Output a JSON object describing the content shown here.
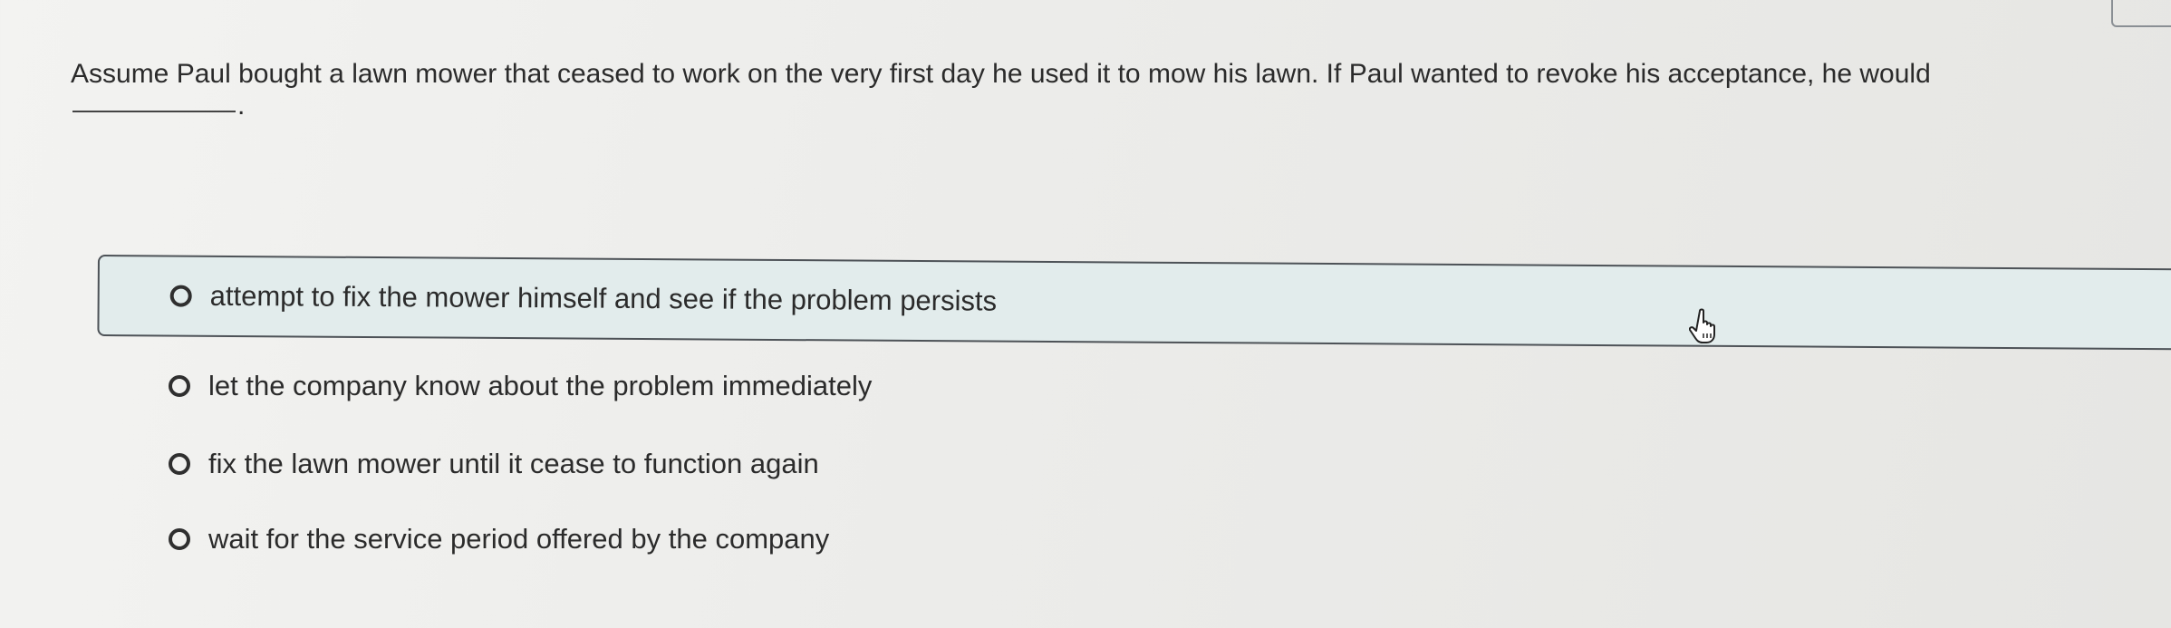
{
  "question": {
    "text": "Assume Paul bought a lawn mower that ceased to work on the very first day he used it to mow his lawn. If Paul wanted to revoke his acceptance, he would",
    "blank_suffix": "."
  },
  "options": [
    {
      "label": "attempt to fix the mower himself and see if the problem persists",
      "selected": true
    },
    {
      "label": "let the company know about the problem immediately",
      "selected": false
    },
    {
      "label": "fix the lawn mower until it cease to function again",
      "selected": false
    },
    {
      "label": "wait for the service period offered by the company",
      "selected": false
    }
  ],
  "icons": {
    "radio": "radio-button-icon",
    "cursor": "hand-pointer-icon"
  },
  "colors": {
    "hover_background": "#e2ecec",
    "hover_border": "#4d5257",
    "text": "#2b2b2b"
  }
}
